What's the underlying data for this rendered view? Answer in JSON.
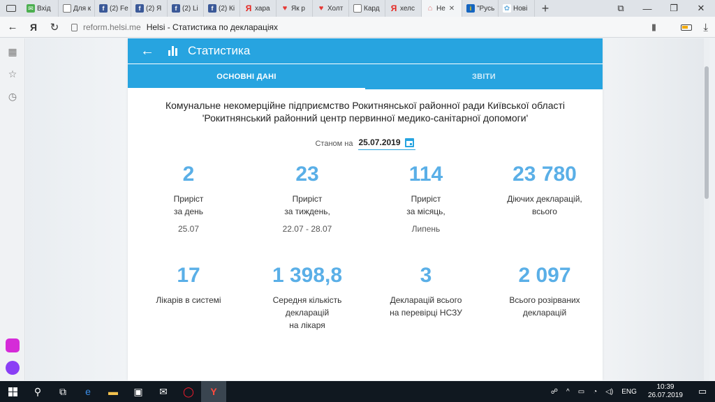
{
  "browser": {
    "tabs": [
      {
        "icon": "gmail",
        "glyph": "✉",
        "label": "Вхід"
      },
      {
        "icon": "doc",
        "glyph": "",
        "label": "Для к"
      },
      {
        "icon": "fb",
        "glyph": "f",
        "label": "(2) Fe"
      },
      {
        "icon": "fb",
        "glyph": "f",
        "label": "(2) Я"
      },
      {
        "icon": "fb",
        "glyph": "f",
        "label": "(2) Li"
      },
      {
        "icon": "fb",
        "glyph": "f",
        "label": "(2) Кі"
      },
      {
        "icon": "ya",
        "glyph": "Я",
        "label": "хара"
      },
      {
        "icon": "heart",
        "glyph": "♥",
        "label": "Як р"
      },
      {
        "icon": "heart",
        "glyph": "♥",
        "label": "Холт"
      },
      {
        "icon": "doc",
        "glyph": "",
        "label": "Кард"
      },
      {
        "icon": "ya",
        "glyph": "Я",
        "label": "хелс"
      },
      {
        "icon": "helsi",
        "glyph": "⌂",
        "label": "Не",
        "active": true
      },
      {
        "icon": "rus",
        "glyph": "i",
        "label": "\"Русь"
      },
      {
        "icon": "nov",
        "glyph": "✿",
        "label": "Нові"
      }
    ],
    "new_tab": "+",
    "address": {
      "domain": "reform.helsi.me",
      "title": "Helsi - Статистика по деклараціях"
    }
  },
  "app": {
    "title": "Статистика",
    "tabs": [
      {
        "label": "Основні дані",
        "active": true
      },
      {
        "label": "Звіти",
        "active": false
      }
    ],
    "org_line1": "Комунальне некомерційне підприємство Рокитнянської районної ради Київської області",
    "org_line2": "'Рокитнянський районний центр первинної медико-санітарної допомоги'",
    "date_label": "Станом на",
    "date_value": "25.07.2019",
    "stats": [
      {
        "value": "2",
        "label_lines": [
          "Приріст",
          "за день"
        ],
        "sub": "25.07"
      },
      {
        "value": "23",
        "label_lines": [
          "Приріст",
          "за тиждень,"
        ],
        "sub": "22.07 - 28.07"
      },
      {
        "value": "114",
        "label_lines": [
          "Приріст",
          "за місяць,"
        ],
        "sub": "Липень"
      },
      {
        "value": "23 780",
        "label_lines": [
          "Діючих декларацій,",
          "всього"
        ],
        "sub": ""
      },
      {
        "value": "17",
        "label_lines": [
          "Лікарів в системі"
        ],
        "sub": ""
      },
      {
        "value": "1 398,8",
        "label_lines": [
          "Середня кількість",
          "декларацій",
          "на лікаря"
        ],
        "sub": ""
      },
      {
        "value": "3",
        "label_lines": [
          "Декларацій всього",
          "на перевірці НСЗУ"
        ],
        "sub": ""
      },
      {
        "value": "2 097",
        "label_lines": [
          "Всього розірваних",
          "декларацій"
        ],
        "sub": ""
      }
    ],
    "accent_color": "#27a4e0",
    "number_color": "#5aafe7"
  },
  "taskbar": {
    "lang": "ENG",
    "time": "10:39",
    "date": "26.07.2019"
  }
}
